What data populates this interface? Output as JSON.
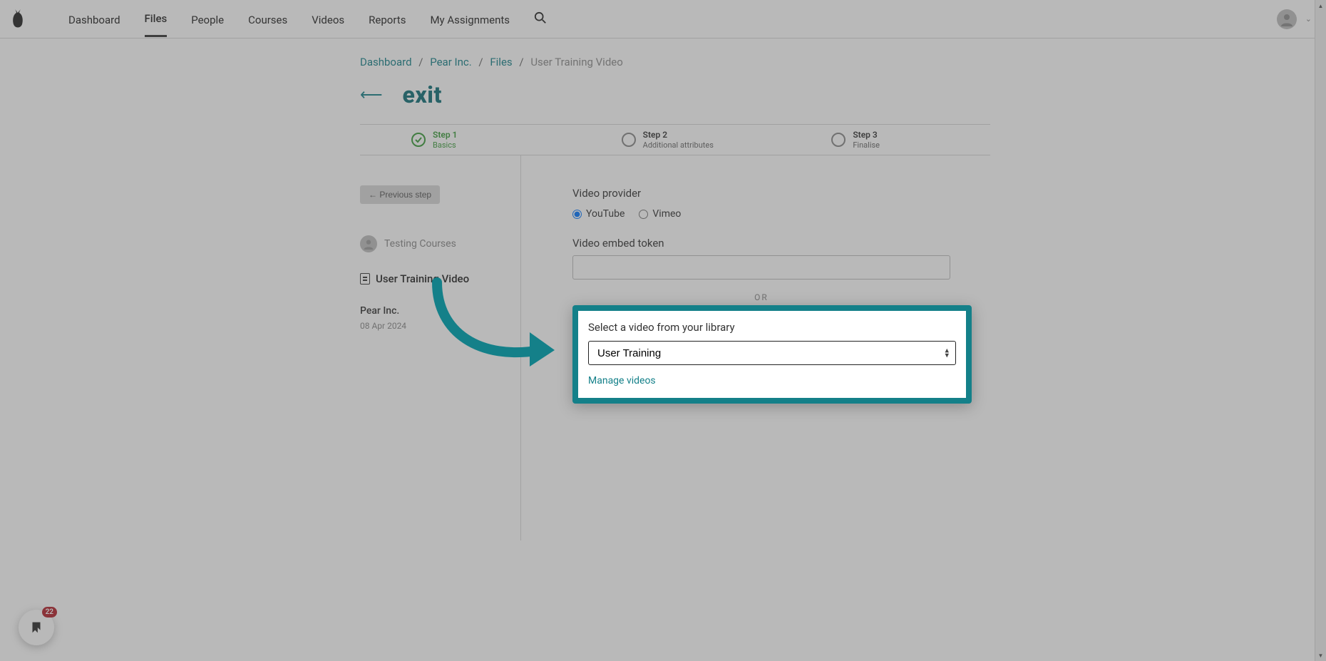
{
  "nav": {
    "items": [
      "Dashboard",
      "Files",
      "People",
      "Courses",
      "Videos",
      "Reports",
      "My Assignments"
    ],
    "activeIndex": 1
  },
  "breadcrumb": {
    "items": [
      "Dashboard",
      "Pear Inc.",
      "Files"
    ],
    "current": "User Training Video"
  },
  "page": {
    "title": "exit"
  },
  "steps": {
    "items": [
      {
        "num": "Step 1",
        "sub": "Basics",
        "active": true,
        "done": true
      },
      {
        "num": "Step 2",
        "sub": "Additional attributes",
        "active": false,
        "done": false
      },
      {
        "num": "Step 3",
        "sub": "Finalise",
        "active": false,
        "done": false
      }
    ]
  },
  "sidebar": {
    "prev_label": "← Previous step",
    "user": "Testing Courses",
    "file": "User Training Video",
    "org": "Pear Inc.",
    "date": "08 Apr 2024"
  },
  "form": {
    "provider_label": "Video provider",
    "provider_options": {
      "youtube": "YouTube",
      "vimeo": "Vimeo"
    },
    "provider_selected": "youtube",
    "token_label": "Video embed token",
    "token_value": "",
    "or_label": "OR",
    "library_label": "Select a video from your library",
    "library_selected": "User Training",
    "manage_link": "Manage videos"
  },
  "widget": {
    "badge": "22"
  }
}
